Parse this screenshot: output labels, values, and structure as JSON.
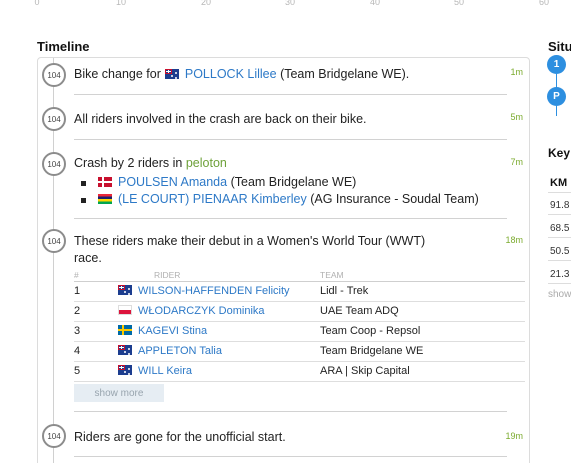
{
  "scale_ticks": [
    "0",
    "10",
    "20",
    "30",
    "40",
    "50",
    "60"
  ],
  "timeline": {
    "title": "Timeline",
    "entries": [
      {
        "km": "104",
        "time": "1m",
        "prefix": "Bike change for",
        "rider": "POLLOCK Lillee",
        "suffix": "(Team Bridgelane WE).",
        "flag": "AU"
      },
      {
        "km": "104",
        "time": "5m",
        "text": "All riders involved in the crash are back on their bike."
      },
      {
        "km": "104",
        "time": "7m",
        "prefix": "Crash by 2 riders in",
        "group": "peloton",
        "riders": [
          {
            "flag": "DK",
            "name": "POULSEN Amanda",
            "team": "(Team Bridgelane WE)"
          },
          {
            "flag": "MU",
            "name": "(LE COURT) PIENAAR Kimberley",
            "team": "(AG Insurance - Soudal Team)"
          }
        ]
      },
      {
        "km": "104",
        "time": "18m",
        "text_line1": "These riders make their debut in a Women's World Tour (WWT)",
        "text_line2": "race.",
        "table": {
          "headers": {
            "rank": "#",
            "rider": "RIDER",
            "team": "TEAM"
          },
          "rows": [
            {
              "rank": "1",
              "flag": "AU",
              "rider": "WILSON-HAFFENDEN Felicity",
              "team": "Lidl - Trek"
            },
            {
              "rank": "2",
              "flag": "PL",
              "rider": "WŁODARCZYK Dominika",
              "team": "UAE Team ADQ"
            },
            {
              "rank": "3",
              "flag": "SE",
              "rider": "KAGEVI Stina",
              "team": "Team Coop - Repsol"
            },
            {
              "rank": "4",
              "flag": "AU",
              "rider": "APPLETON Talia",
              "team": "Team Bridgelane WE"
            },
            {
              "rank": "5",
              "flag": "AU",
              "rider": "WILL Keira",
              "team": "ARA | Skip Capital"
            }
          ]
        },
        "show_more": "show more"
      },
      {
        "km": "104",
        "time": "19m",
        "text": "Riders are gone for the unofficial start."
      }
    ]
  },
  "sidebar": {
    "title_partial": "Situ",
    "markers": [
      "1",
      "P"
    ],
    "keys_title_partial": "Key",
    "km_header": "KM",
    "km_values": [
      "91.8",
      "68.5",
      "50.5",
      "21.3"
    ],
    "more_partial": "show"
  },
  "colors": {
    "link": "#2d79c7",
    "time": "#7cab2f",
    "peloton": "#6ea13a",
    "marker": "#2d8fe0"
  }
}
